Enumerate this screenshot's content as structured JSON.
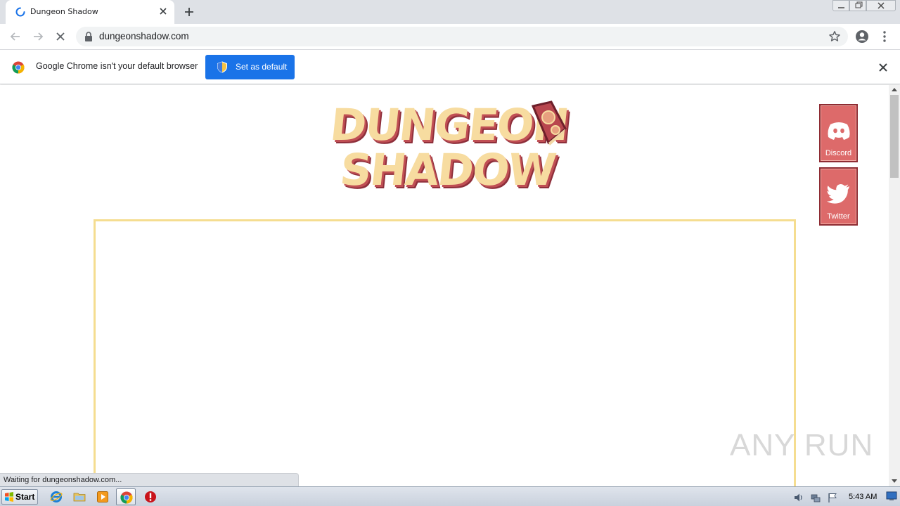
{
  "browser": {
    "tab": {
      "title": "Dungeon Shadow",
      "loading": true
    },
    "omnibox": {
      "url": "dungeonshadow.com"
    },
    "infobar": {
      "message": "Google Chrome isn't your default browser",
      "button_label": "Set as default"
    },
    "status": "Waiting for dungeonshadow.com..."
  },
  "page": {
    "logo": {
      "line1": "DUNGEON",
      "line2": "SHADOW"
    },
    "social": [
      {
        "label": "Discord",
        "icon": "discord-icon"
      },
      {
        "label": "Twitter",
        "icon": "twitter-icon"
      }
    ],
    "watermark": "ANY RUN"
  },
  "taskbar": {
    "start_label": "Start",
    "apps": [
      "ie-icon",
      "explorer-icon",
      "media-player-icon",
      "chrome-icon",
      "stop-icon"
    ],
    "clock": "5:43 AM"
  },
  "colors": {
    "accent_blue": "#1a73e8",
    "logo_cream": "#f7dca0",
    "logo_red": "#c04f54",
    "social_red": "#dd6a6a",
    "frame_yellow": "#f5dd90"
  }
}
